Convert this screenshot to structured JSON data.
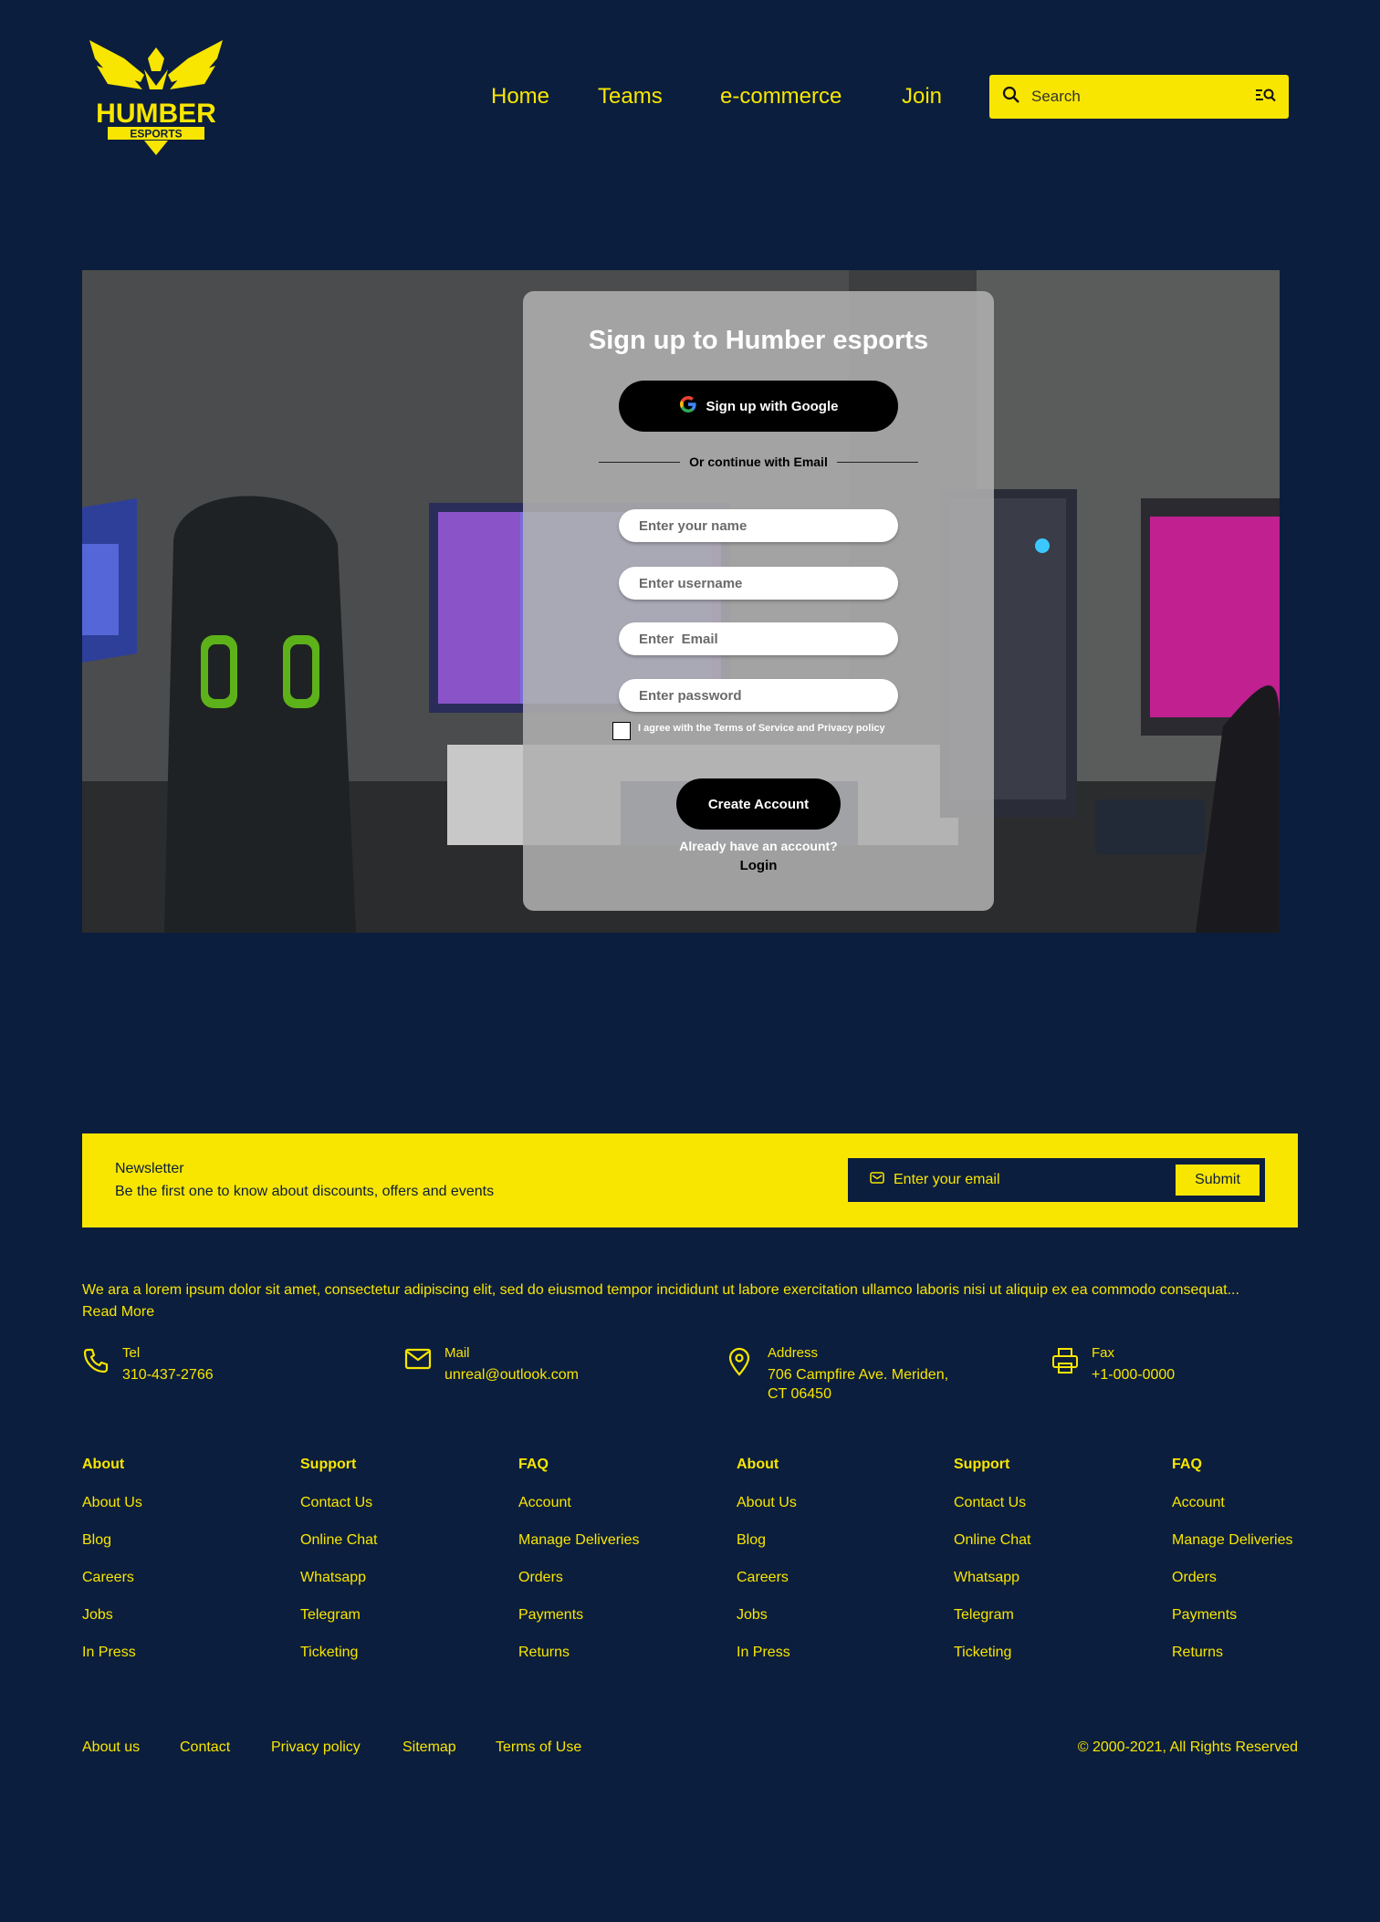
{
  "brand": {
    "logo_text": "HUMBER",
    "logo_subtext": "ESPORTS",
    "accent": "#f8e600",
    "background": "#0c1e3d"
  },
  "nav": {
    "items": [
      "Home",
      "Teams",
      "e-commerce",
      "Join"
    ]
  },
  "search": {
    "placeholder": "Search",
    "icon": "search-icon",
    "filter_icon": "filter-search-icon"
  },
  "signup": {
    "title": "Sign up to Humber esports",
    "google_button": "Sign up with Google",
    "divider": "Or continue with Email",
    "name_placeholder": "Enter your name",
    "username_placeholder": "Enter username",
    "email_placeholder": "Enter  Email",
    "password_placeholder": "Enter password",
    "agree_text": "I agree with the Terms of Service and Privacy policy",
    "create_button": "Create Account",
    "already_text": "Already have an account?",
    "login_link": "Login"
  },
  "newsletter": {
    "title": "Newsletter",
    "subtitle": "Be the first one to know  about discounts, offers and events",
    "email_placeholder": "Enter your email",
    "submit": "Submit"
  },
  "about": {
    "text": "We ara a lorem ipsum dolor sit amet, consectetur adipiscing elit, sed do eiusmod tempor incididunt ut labore exercitation ullamco laboris nisi ut aliquip ex ea commodo consequat...",
    "read_more": "Read More"
  },
  "contacts": [
    {
      "label": "Tel",
      "value": "310-437-2766",
      "icon": "phone-icon"
    },
    {
      "label": "Mail",
      "value": "unreal@outlook.com",
      "icon": "mail-icon"
    },
    {
      "label": "Address",
      "value": "706 Campfire Ave. Meriden,",
      "value2": "CT 06450",
      "icon": "location-pin-icon"
    },
    {
      "label": "Fax",
      "value": "+1-000-0000",
      "icon": "printer-icon"
    }
  ],
  "columns": [
    {
      "title": "About",
      "links": [
        "About Us",
        "Blog",
        "Careers",
        "Jobs",
        "In Press"
      ]
    },
    {
      "title": "Support",
      "links": [
        "Contact Us",
        "Online Chat",
        "Whatsapp",
        "Telegram",
        "Ticketing"
      ]
    },
    {
      "title": "FAQ",
      "links": [
        "Account",
        "Manage Deliveries",
        "Orders",
        "Payments",
        "Returns"
      ]
    },
    {
      "title": "About",
      "links": [
        "About Us",
        "Blog",
        "Careers",
        "Jobs",
        "In Press"
      ]
    },
    {
      "title": "Support",
      "links": [
        "Contact Us",
        "Online Chat",
        "Whatsapp",
        "Telegram",
        "Ticketing"
      ]
    },
    {
      "title": "FAQ",
      "links": [
        "Account",
        "Manage Deliveries",
        "Orders",
        "Payments",
        "Returns"
      ]
    }
  ],
  "bottom_links": [
    "About us",
    "Contact",
    "Privacy policy",
    "Sitemap",
    "Terms of Use"
  ],
  "copyright": "© 2000-2021, All Rights Reserved"
}
